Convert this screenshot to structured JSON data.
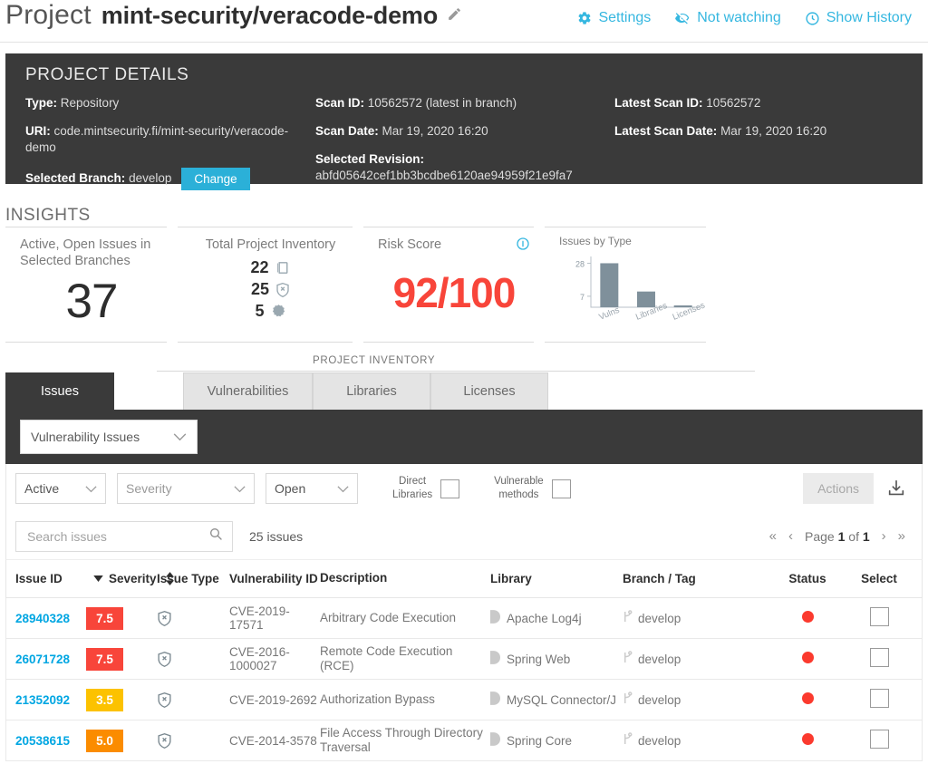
{
  "header": {
    "title_prefix": "Project",
    "project_name": "mint-security/veracode-demo",
    "edit_icon": "pencil-icon",
    "actions": [
      {
        "label": "Settings",
        "icon": "gear-icon"
      },
      {
        "label": "Not watching",
        "icon": "eye-slash-icon"
      },
      {
        "label": "Show History",
        "icon": "clock-icon"
      }
    ]
  },
  "project_details": {
    "heading": "PROJECT DETAILS",
    "type_label": "Type:",
    "type_value": "Repository",
    "uri_label": "URI:",
    "uri_value": "code.mintsecurity.fi/mint-security/veracode-demo",
    "branch_label": "Selected Branch:",
    "branch_value": "develop",
    "change_button": "Change",
    "scan_id_label": "Scan ID:",
    "scan_id_value": "10562572 (latest in branch)",
    "scan_date_label": "Scan Date:",
    "scan_date_value": "Mar 19, 2020 16:20",
    "revision_label": "Selected Revision:",
    "revision_value": "abfd05642cef1bb3bcdbe6120ae94959f21e9fa7",
    "latest_scan_id_label": "Latest Scan ID:",
    "latest_scan_id_value": "10562572",
    "latest_scan_date_label": "Latest Scan Date:",
    "latest_scan_date_value": "Mar 19, 2020 16:20"
  },
  "insights": {
    "heading": "INSIGHTS",
    "open_issues": {
      "title_line1": "Active, Open Issues in",
      "title_line2": "Selected Branches",
      "value": "37"
    },
    "inventory": {
      "title": "Total Project Inventory",
      "rows": [
        {
          "value": "22",
          "icon": "library-book-icon"
        },
        {
          "value": "25",
          "icon": "vulnerability-shield-icon"
        },
        {
          "value": "5",
          "icon": "license-seal-icon"
        }
      ]
    },
    "risk": {
      "title": "Risk Score",
      "info_icon": "info-icon",
      "value": "92/100",
      "color": "#f8453a"
    }
  },
  "chart_data": {
    "type": "bar",
    "title": "Issues by Type",
    "categories": [
      "Vulns",
      "Libraries",
      "Licenses"
    ],
    "values": [
      28,
      10,
      1
    ],
    "xlabel": "",
    "ylabel": "",
    "ylim": [
      0,
      30
    ],
    "ytick_labels": [
      "28",
      "7"
    ],
    "ytick_values": [
      28,
      7
    ],
    "grid": false,
    "legend": false,
    "bar_color": "#7f909b"
  },
  "tabs": {
    "inventory_caption": "PROJECT INVENTORY",
    "items": [
      {
        "label": "Issues",
        "active": true
      },
      {
        "label": "Vulnerabilities",
        "active": false
      },
      {
        "label": "Libraries",
        "active": false
      },
      {
        "label": "Licenses",
        "active": false
      }
    ]
  },
  "filters": {
    "issue_type_select": "Vulnerability Issues",
    "state_select": "Active",
    "severity_select": "Severity",
    "open_select": "Open",
    "direct_libraries_label_line1": "Direct",
    "direct_libraries_label_line2": "Libraries",
    "vulnerable_methods_label_line1": "Vulnerable",
    "vulnerable_methods_label_line2": "methods",
    "actions_button": "Actions",
    "download_icon": "download-icon"
  },
  "search": {
    "placeholder": "Search issues",
    "value": "",
    "icon": "search-icon",
    "count_text": "25 issues"
  },
  "pagination": {
    "first_icon": "double-chevron-left-icon",
    "prev_icon": "chevron-left-icon",
    "page_word": "Page",
    "current": "1",
    "of_word": "of",
    "total": "1",
    "next_icon": "chevron-right-icon",
    "last_icon": "double-chevron-right-icon"
  },
  "table": {
    "columns": [
      "Issue ID",
      "Severity",
      "Issue Type",
      "Vulnerability ID",
      "Description",
      "Library",
      "Branch / Tag",
      "Status",
      "Select"
    ],
    "rows": [
      {
        "issue_id": "28940328",
        "severity": "7.5",
        "severity_color": "#f8453a",
        "issue_type_icon": "vulnerability-shield-icon",
        "vulnerability_id": "CVE-2019-17571",
        "description": "Arbitrary Code Execution",
        "library": "Apache Log4j",
        "branch": "develop",
        "status": "open",
        "selected": false
      },
      {
        "issue_id": "26071728",
        "severity": "7.5",
        "severity_color": "#f8453a",
        "issue_type_icon": "vulnerability-shield-icon",
        "vulnerability_id": "CVE-2016-1000027",
        "description": "Remote Code Execution (RCE)",
        "library": "Spring Web",
        "branch": "develop",
        "status": "open",
        "selected": false
      },
      {
        "issue_id": "21352092",
        "severity": "3.5",
        "severity_color": "#fcc200",
        "issue_type_icon": "vulnerability-shield-icon",
        "vulnerability_id": "CVE-2019-2692",
        "description": "Authorization Bypass",
        "library": "MySQL Connector/J",
        "branch": "develop",
        "status": "open",
        "selected": false
      },
      {
        "issue_id": "20538615",
        "severity": "5.0",
        "severity_color": "#fb8c00",
        "issue_type_icon": "vulnerability-shield-icon",
        "vulnerability_id": "CVE-2014-3578",
        "description": "File Access Through Directory Traversal",
        "library": "Spring Core",
        "branch": "develop",
        "status": "open",
        "selected": false
      }
    ]
  }
}
